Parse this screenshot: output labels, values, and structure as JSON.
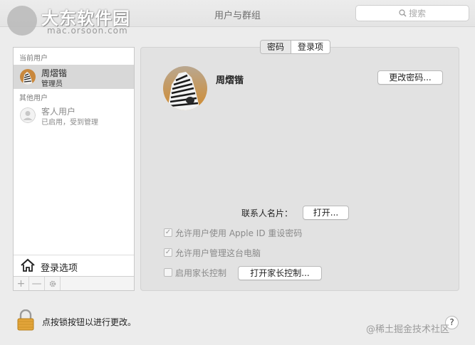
{
  "window": {
    "title": "用户与群组"
  },
  "watermark": {
    "line1": "大东软件园",
    "line2": "mac.orsoon.com"
  },
  "search": {
    "placeholder": "搜索",
    "icon": "search-icon"
  },
  "sidebar": {
    "current_users_label": "当前用户",
    "current_user": {
      "name": "周熠锴",
      "role": "管理员"
    },
    "other_users_label": "其他用户",
    "guest_user": {
      "name": "客人用户",
      "role": "已启用，受到管理"
    },
    "login_options_label": "登录选项",
    "toolbar": {
      "add": "+",
      "remove": "—"
    }
  },
  "tabs": {
    "password": "密码",
    "login_items": "登录项"
  },
  "profile": {
    "name": "周熠锴",
    "change_password": "更改密码..."
  },
  "contact": {
    "label": "联系人名片：",
    "open_button": "打开..."
  },
  "options": {
    "allow_apple_id_reset": "允许用户使用 Apple ID 重设密码",
    "allow_admin": "允许用户管理这台电脑",
    "parental_controls": "启用家长控制",
    "open_parental_controls": "打开家长控制..."
  },
  "footer": {
    "lock_text": "点按锁按钮以进行更改。",
    "help": "?",
    "watermark": "@稀土掘金技术社区"
  }
}
